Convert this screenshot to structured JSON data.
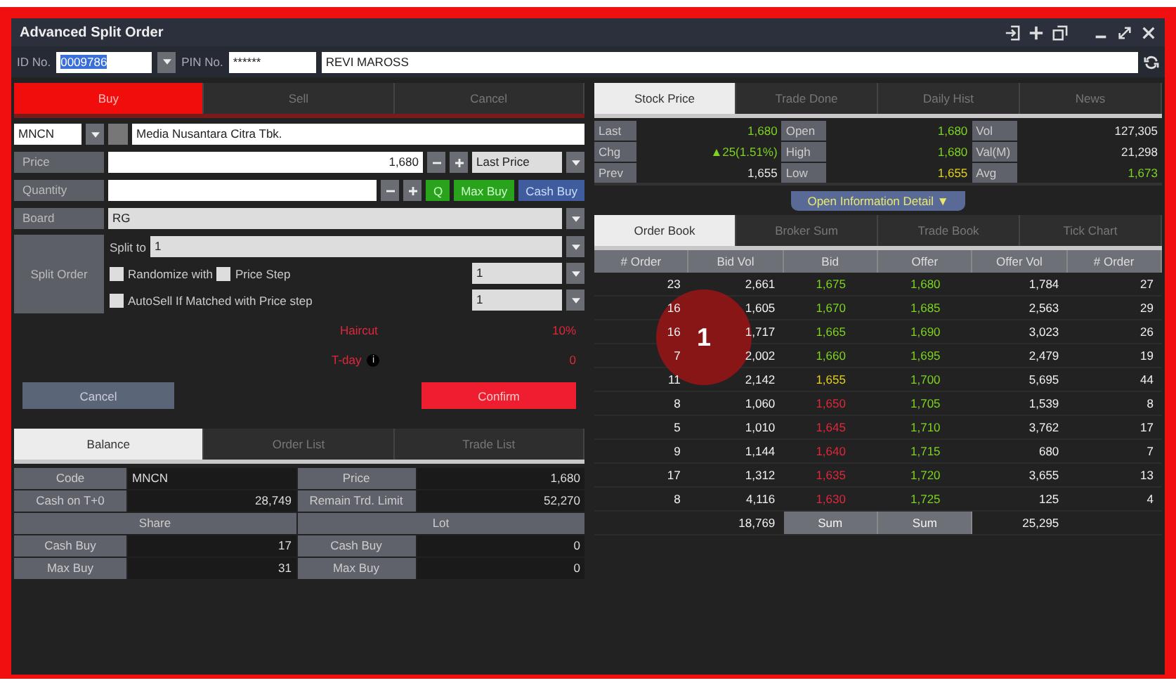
{
  "window": {
    "title": "Advanced Split Order"
  },
  "account": {
    "id_label": "ID No.",
    "id_value": "0009786",
    "pin_label": "PIN No.",
    "pin_value": "******",
    "name_value": "REVI MAROSS"
  },
  "order_tabs": [
    {
      "label": "Buy",
      "selected": true
    },
    {
      "label": "Sell",
      "selected": false
    },
    {
      "label": "Cancel",
      "selected": false
    }
  ],
  "stock": {
    "code": "MNCN",
    "name": "Media Nusantara Citra Tbk."
  },
  "form": {
    "price_label": "Price",
    "price_value": "1,680",
    "price_type": "Last Price",
    "quantity_label": "Quantity",
    "q_button": "Q",
    "max_buy_button": "Max Buy",
    "cash_buy_button": "Cash Buy",
    "board_label": "Board",
    "board_value": "RG",
    "split_label": "Split Order",
    "split_to_label": "Split to",
    "split_to_value": "1",
    "randomize": {
      "label": "Randomize with",
      "checked": false
    },
    "price_step": {
      "label": "Price Step",
      "checked": false
    },
    "price_step_value": "1",
    "autosell": {
      "label": "AutoSell If Matched with Price step",
      "checked": false
    },
    "autosell_value": "1",
    "haircut_label": "Haircut",
    "haircut_value": "10%",
    "tday_label": "T-day",
    "tday_icon": "i",
    "tday_value": "0",
    "cancel_button": "Cancel",
    "confirm_button": "Confirm"
  },
  "balance_tabs": [
    {
      "label": "Balance",
      "selected": true
    },
    {
      "label": "Order List",
      "selected": false
    },
    {
      "label": "Trade List",
      "selected": false
    }
  ],
  "balance": {
    "code_label": "Code",
    "code_value": "MNCN",
    "price_label": "Price",
    "price_value": "1,680",
    "cash_label": "Cash on T+0",
    "cash_value": "28,749",
    "remain_label": "Remain Trd. Limit",
    "remain_value": "52,270",
    "share_label": "Share",
    "lot_label": "Lot",
    "rows": [
      {
        "label": "Cash Buy",
        "share": "17",
        "lot_label": "Cash Buy",
        "lot": "0"
      },
      {
        "label": "Max Buy",
        "share": "31",
        "lot_label": "Max Buy",
        "lot": "0"
      }
    ]
  },
  "info_tabs": [
    {
      "label": "Stock Price",
      "selected": true
    },
    {
      "label": "Trade Done",
      "selected": false
    },
    {
      "label": "Daily Hist",
      "selected": false
    },
    {
      "label": "News",
      "selected": false
    }
  ],
  "stock_price": [
    [
      {
        "label": "Last",
        "value": "1,680",
        "color": "#7cd321"
      },
      {
        "label": "Open",
        "value": "1,680",
        "color": "#7cd321"
      },
      {
        "label": "Vol",
        "value": "127,305",
        "color": "#e8e8e8"
      }
    ],
    [
      {
        "label": "Chg",
        "value": "▲25(1.51%)",
        "color": "#7cd321"
      },
      {
        "label": "High",
        "value": "1,680",
        "color": "#7cd321"
      },
      {
        "label": "Val(M)",
        "value": "21,298",
        "color": "#e8e8e8"
      }
    ],
    [
      {
        "label": "Prev",
        "value": "1,655",
        "color": "#e8e8e8"
      },
      {
        "label": "Low",
        "value": "1,655",
        "color": "#e3d21c"
      },
      {
        "label": "Avg",
        "value": "1,673",
        "color": "#7cd321"
      }
    ]
  ],
  "open_info_button": "Open Information Detail ▼",
  "book_tabs": [
    {
      "label": "Order Book",
      "selected": true
    },
    {
      "label": "Broker Sum",
      "selected": false
    },
    {
      "label": "Trade Book",
      "selected": false
    },
    {
      "label": "Tick Chart",
      "selected": false
    }
  ],
  "order_book": {
    "columns": [
      "# Order",
      "Bid Vol",
      "Bid",
      "Offer",
      "Offer Vol",
      "# Order"
    ],
    "rows": [
      {
        "bid_orders": "23",
        "bid_vol": "2,661",
        "bid": {
          "text": "1,675",
          "color": "#7cd321"
        },
        "offer": {
          "text": "1,680",
          "color": "#7cd321"
        },
        "offer_vol": "1,784",
        "offer_orders": "27"
      },
      {
        "bid_orders": "16",
        "bid_vol": "1,605",
        "bid": {
          "text": "1,670",
          "color": "#7cd321"
        },
        "offer": {
          "text": "1,685",
          "color": "#7cd321"
        },
        "offer_vol": "2,563",
        "offer_orders": "29"
      },
      {
        "bid_orders": "16",
        "bid_vol": "1,717",
        "bid": {
          "text": "1,665",
          "color": "#7cd321"
        },
        "offer": {
          "text": "1,690",
          "color": "#7cd321"
        },
        "offer_vol": "3,023",
        "offer_orders": "26"
      },
      {
        "bid_orders": "7",
        "bid_vol": "2,002",
        "bid": {
          "text": "1,660",
          "color": "#7cd321"
        },
        "offer": {
          "text": "1,695",
          "color": "#7cd321"
        },
        "offer_vol": "2,479",
        "offer_orders": "19"
      },
      {
        "bid_orders": "11",
        "bid_vol": "2,142",
        "bid": {
          "text": "1,655",
          "color": "#e3d21c"
        },
        "offer": {
          "text": "1,700",
          "color": "#7cd321"
        },
        "offer_vol": "5,695",
        "offer_orders": "44"
      },
      {
        "bid_orders": "8",
        "bid_vol": "1,060",
        "bid": {
          "text": "1,650",
          "color": "#e0283c"
        },
        "offer": {
          "text": "1,705",
          "color": "#7cd321"
        },
        "offer_vol": "1,539",
        "offer_orders": "8"
      },
      {
        "bid_orders": "5",
        "bid_vol": "1,010",
        "bid": {
          "text": "1,645",
          "color": "#e0283c"
        },
        "offer": {
          "text": "1,710",
          "color": "#7cd321"
        },
        "offer_vol": "3,762",
        "offer_orders": "17"
      },
      {
        "bid_orders": "9",
        "bid_vol": "1,144",
        "bid": {
          "text": "1,640",
          "color": "#e0283c"
        },
        "offer": {
          "text": "1,715",
          "color": "#7cd321"
        },
        "offer_vol": "680",
        "offer_orders": "7"
      },
      {
        "bid_orders": "17",
        "bid_vol": "1,312",
        "bid": {
          "text": "1,635",
          "color": "#e0283c"
        },
        "offer": {
          "text": "1,720",
          "color": "#7cd321"
        },
        "offer_vol": "3,655",
        "offer_orders": "13"
      },
      {
        "bid_orders": "8",
        "bid_vol": "4,116",
        "bid": {
          "text": "1,630",
          "color": "#e0283c"
        },
        "offer": {
          "text": "1,725",
          "color": "#7cd321"
        },
        "offer_vol": "125",
        "offer_orders": "4"
      }
    ],
    "totals": {
      "bid_vol": "18,769",
      "bid": "Sum",
      "offer": "Sum",
      "offer_vol": "25,295"
    }
  },
  "callout": {
    "number": "1"
  }
}
